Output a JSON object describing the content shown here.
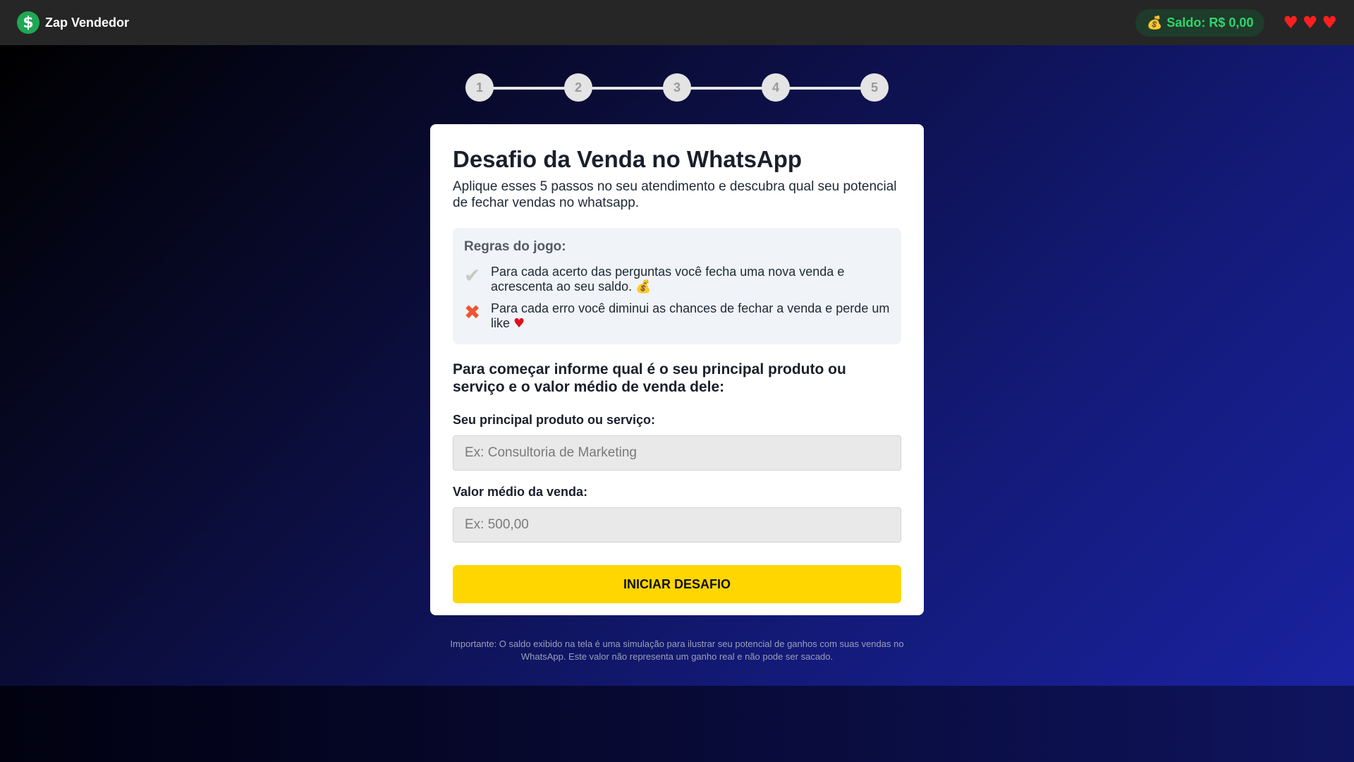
{
  "header": {
    "logo_symbol": "$",
    "brand_name": "Zap Vendedor",
    "balance_icon": "money-bag-icon",
    "balance_emoji": "💰",
    "balance_label": "Saldo: R$ 0,00",
    "lives": [
      "♥",
      "♥",
      "♥"
    ],
    "colors": {
      "balance_text": "#2fd66b",
      "heart": "#ff1f1f",
      "logo_bg": "#1fa855"
    }
  },
  "stepper": {
    "steps": [
      "1",
      "2",
      "3",
      "4",
      "5"
    ]
  },
  "card": {
    "title": "Desafio da Venda no WhatsApp",
    "subtitle": "Aplique esses 5 passos no seu atendimento e descubra qual seu potencial de fechar vendas no whatsapp.",
    "rules": {
      "title": "Regras do jogo:",
      "items": [
        {
          "icon": "check-mark-icon",
          "glyph": "✔",
          "text": "Para cada acerto das perguntas você fecha uma nova venda e acrescenta ao seu saldo.",
          "emoji": "💰"
        },
        {
          "icon": "cross-mark-icon",
          "glyph": "✖",
          "text": "Para cada erro você diminui as chances de fechar a venda e perde um like",
          "emoji": "♥"
        }
      ]
    },
    "prompt": "Para começar informe qual é o seu principal produto ou serviço e o valor médio de venda dele:",
    "product_field": {
      "label": "Seu principal produto ou serviço:",
      "placeholder": "Ex: Consultoria de Marketing",
      "value": ""
    },
    "value_field": {
      "label": "Valor médio da venda:",
      "placeholder": "Ex: 500,00",
      "value": ""
    },
    "start_button": "INICIAR DESAFIO",
    "colors": {
      "button": "#ffd600"
    }
  },
  "disclaimer": "Importante: O saldo exibido na tela é uma simulação para ilustrar seu potencial de ganhos com suas vendas no WhatsApp. Este valor não representa um ganho real e não pode ser sacado."
}
